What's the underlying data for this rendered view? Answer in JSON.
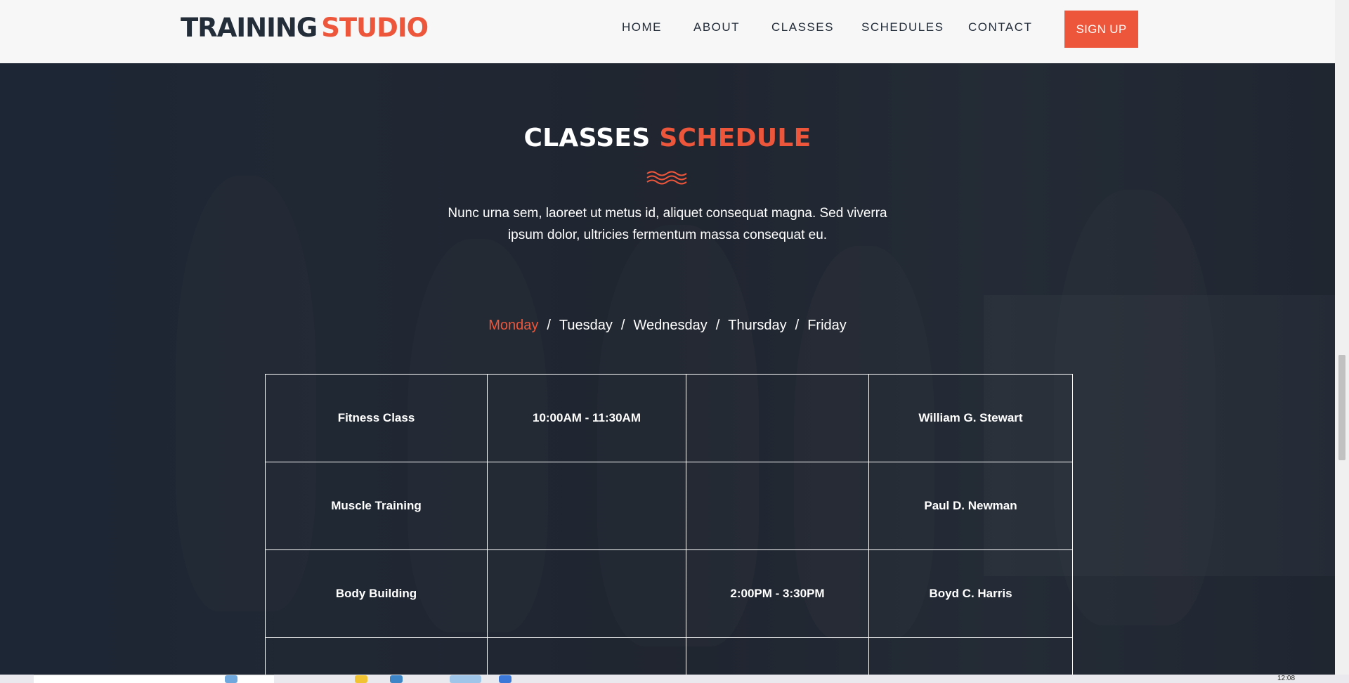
{
  "brand": {
    "part1": "TRAINING",
    "part2": "STUDIO"
  },
  "nav": {
    "items": [
      "HOME",
      "ABOUT",
      "CLASSES",
      "SCHEDULES",
      "CONTACT"
    ],
    "signup": "SIGN UP"
  },
  "section": {
    "title_main": "CLASSES",
    "title_accent": "SCHEDULE",
    "description_line1": "Nunc urna sem, laoreet ut metus id, aliquet consequat magna. Sed viverra",
    "description_line2": "ipsum dolor, ultricies fermentum massa consequat eu."
  },
  "days": {
    "active": "Monday",
    "items": [
      "Monday",
      "Tuesday",
      "Wednesday",
      "Thursday",
      "Friday"
    ],
    "separator": "/"
  },
  "schedule": {
    "rows": [
      [
        "Fitness Class",
        "10:00AM - 11:30AM",
        "",
        "William G. Stewart"
      ],
      [
        "Muscle Training",
        "",
        "",
        "Paul D. Newman"
      ],
      [
        "Body Building",
        "",
        "2:00PM - 3:30PM",
        "Boyd C. Harris"
      ],
      [
        "",
        "",
        "",
        ""
      ]
    ]
  },
  "taskbar": {
    "clock": "12:08"
  },
  "colors": {
    "accent": "#ed563b",
    "dark": "#232d39",
    "header_bg": "#f7f7f7"
  }
}
